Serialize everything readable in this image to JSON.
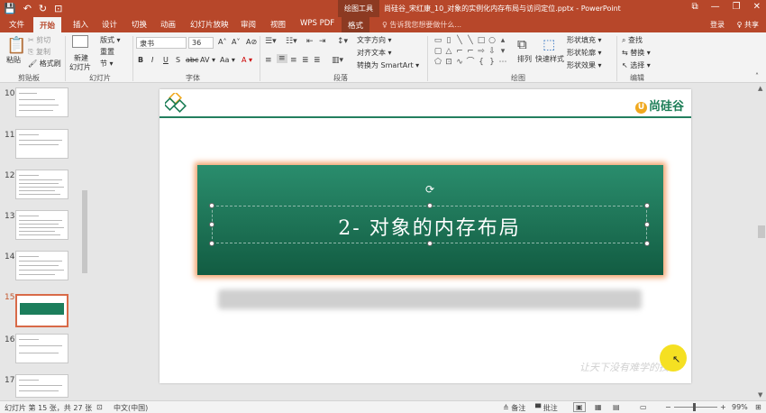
{
  "titlebar": {
    "quick_access": [
      "💾",
      "↶",
      "↻",
      "⊡"
    ],
    "context_tools": "绘图工具",
    "title": "尚硅谷_宋红康_10_对象的实例化内存布局与访问定位.pptx - PowerPoint",
    "win_controls": [
      "⧉",
      "—",
      "❐",
      "✕"
    ]
  },
  "tabs": {
    "file": "文件",
    "home": "开始",
    "insert": "插入",
    "design": "设计",
    "transitions": "切换",
    "animations": "动画",
    "slideshow": "幻灯片放映",
    "review": "审阅",
    "view": "视图",
    "wpspdf": "WPS PDF",
    "format": "格式",
    "tellme": "♀ 告诉我您想要做什么...",
    "login": "登录",
    "share": "♀ 共享"
  },
  "ribbon": {
    "clipboard": {
      "paste": "粘贴",
      "cut": "✂ 剪切",
      "copy": "⎘ 复制",
      "painter": "🖌 格式刷",
      "label": "剪贴板"
    },
    "slides": {
      "new": "新建",
      "new2": "幻灯片",
      "layout": "版式 ▾",
      "reset": "重置",
      "section": "节 ▾",
      "label": "幻灯片"
    },
    "font": {
      "name": "隶书",
      "size": "36",
      "grow": "A˄",
      "shrink": "A˅",
      "clear": "A⊘",
      "bold": "B",
      "italic": "I",
      "underline": "U",
      "shadow": "S",
      "strike": "abc",
      "spacing": "AV ▾",
      "case": "Aa ▾",
      "color": "A ▾",
      "label": "字体"
    },
    "paragraph": {
      "text_dir": "文字方向 ▾",
      "align_text": "对齐文本 ▾",
      "smartart": "转换为 SmartArt ▾",
      "label": "段落"
    },
    "drawing": {
      "arrange": "排列",
      "quickstyles": "快速样式",
      "fill": "形状填充 ▾",
      "outline": "形状轮廓 ▾",
      "effects": "形状效果 ▾",
      "label": "绘图"
    },
    "editing": {
      "find": "查找",
      "replace": "替换 ▾",
      "select": "选择 ▾",
      "label": "编辑"
    }
  },
  "thumbnails": [
    {
      "num": "10",
      "active": false
    },
    {
      "num": "11",
      "active": false
    },
    {
      "num": "12",
      "active": false
    },
    {
      "num": "13",
      "active": false
    },
    {
      "num": "14",
      "active": false
    },
    {
      "num": "15",
      "active": true
    },
    {
      "num": "16",
      "active": false
    },
    {
      "num": "17",
      "active": false
    }
  ],
  "slide": {
    "brand": "尚硅谷",
    "title": "2- 对象的内存布局",
    "motto": "让天下没有难学的技术"
  },
  "status": {
    "slide_info": "幻灯片 第 15 张，共 27 张",
    "language": "中文(中国)",
    "notes": "≙ 备注",
    "comments": "▀ 批注",
    "zoom": "99%"
  },
  "colors": {
    "accent": "#b7472a",
    "slide_green": "#1d7255",
    "glow": "#f3a36d"
  }
}
